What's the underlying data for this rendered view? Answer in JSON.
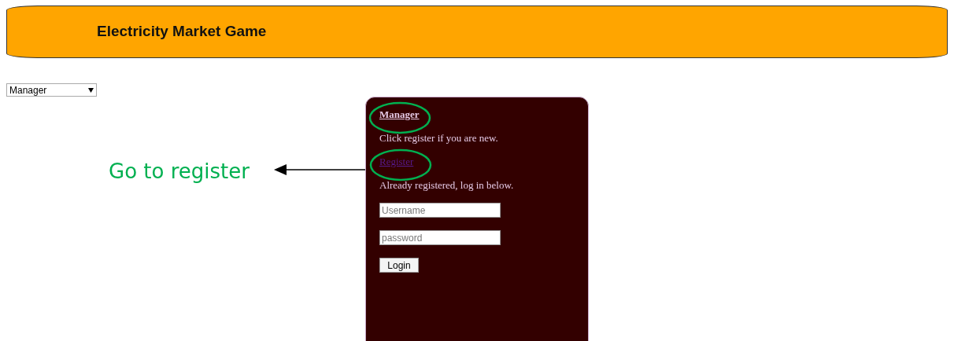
{
  "header": {
    "title": "Electricity Market Game"
  },
  "role_select": {
    "value": "Manager"
  },
  "login_card": {
    "heading": "Manager",
    "intro": "Click register if you are new.",
    "register_link": "Register",
    "login_prompt": "Already registered, log in below.",
    "fields": [
      {
        "placeholder": "Username"
      },
      {
        "placeholder": "password"
      }
    ],
    "login_button": "Login"
  },
  "annotation": {
    "text": "Go to register"
  }
}
